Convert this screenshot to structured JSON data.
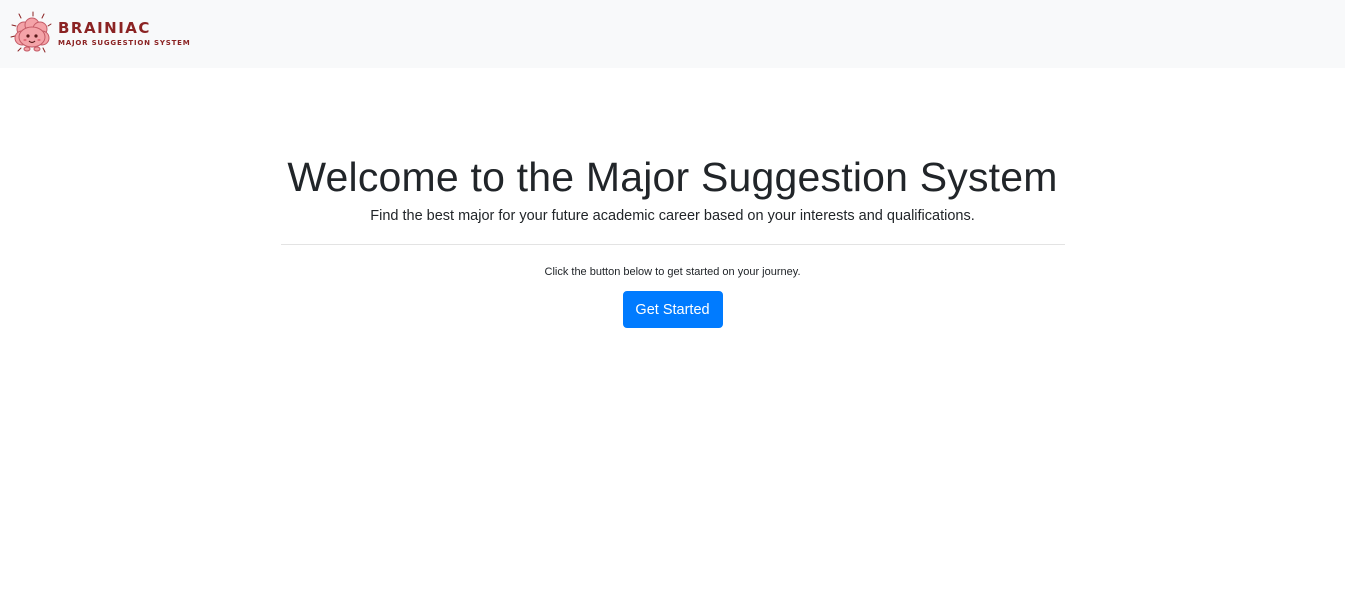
{
  "navbar": {
    "brand_name": "BRAINIAC",
    "brand_tagline": "MAJOR SUGGESTION SYSTEM",
    "logo_icon": "brain-mascot-icon",
    "background": "#f8f9fa",
    "brand_color": "#8b2323"
  },
  "hero": {
    "title": "Welcome to the Major Suggestion System",
    "lead": "Find the best major for your future academic career based on your interests and qualifications.",
    "instruction": "Click the button below to get started on your journey.",
    "cta_label": "Get Started",
    "cta_color": "#007bff"
  }
}
